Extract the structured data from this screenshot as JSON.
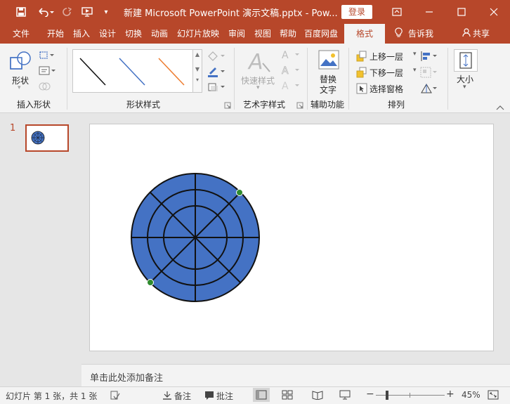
{
  "title_bar": {
    "title": "新建 Microsoft PowerPoint 演示文稿.pptx  -  Pow...",
    "login": "登录"
  },
  "tabs": [
    "文件",
    "开始",
    "插入",
    "设计",
    "切换",
    "动画",
    "幻灯片放映",
    "审阅",
    "视图",
    "帮助",
    "百度网盘",
    "格式"
  ],
  "tell_me": "告诉我",
  "share": "共享",
  "ribbon": {
    "insert_shapes": {
      "shape_label": "形状",
      "group_label": "插入形状"
    },
    "shape_styles": {
      "group_label": "形状样式"
    },
    "wordart": {
      "quick_styles": "快速样式",
      "group_label": "艺术字样式"
    },
    "accessibility": {
      "alt_text_line1": "替换",
      "alt_text_line2": "文字",
      "group_label": "辅助功能"
    },
    "arrange": {
      "bring_forward": "上移一层",
      "send_backward": "下移一层",
      "selection_pane": "选择窗格",
      "group_label": "排列"
    },
    "size": {
      "label": "大小"
    }
  },
  "thumbnail": {
    "number": "1"
  },
  "notes_placeholder": "单击此处添加备注",
  "status_bar": {
    "slide_info": "幻灯片 第 1 张，共 1 张",
    "notes": "备注",
    "comments": "批注",
    "zoom": "45%"
  },
  "colors": {
    "accent": "#b7472a",
    "shape_fill": "#4472c4",
    "handle": "#2e8b2e"
  }
}
